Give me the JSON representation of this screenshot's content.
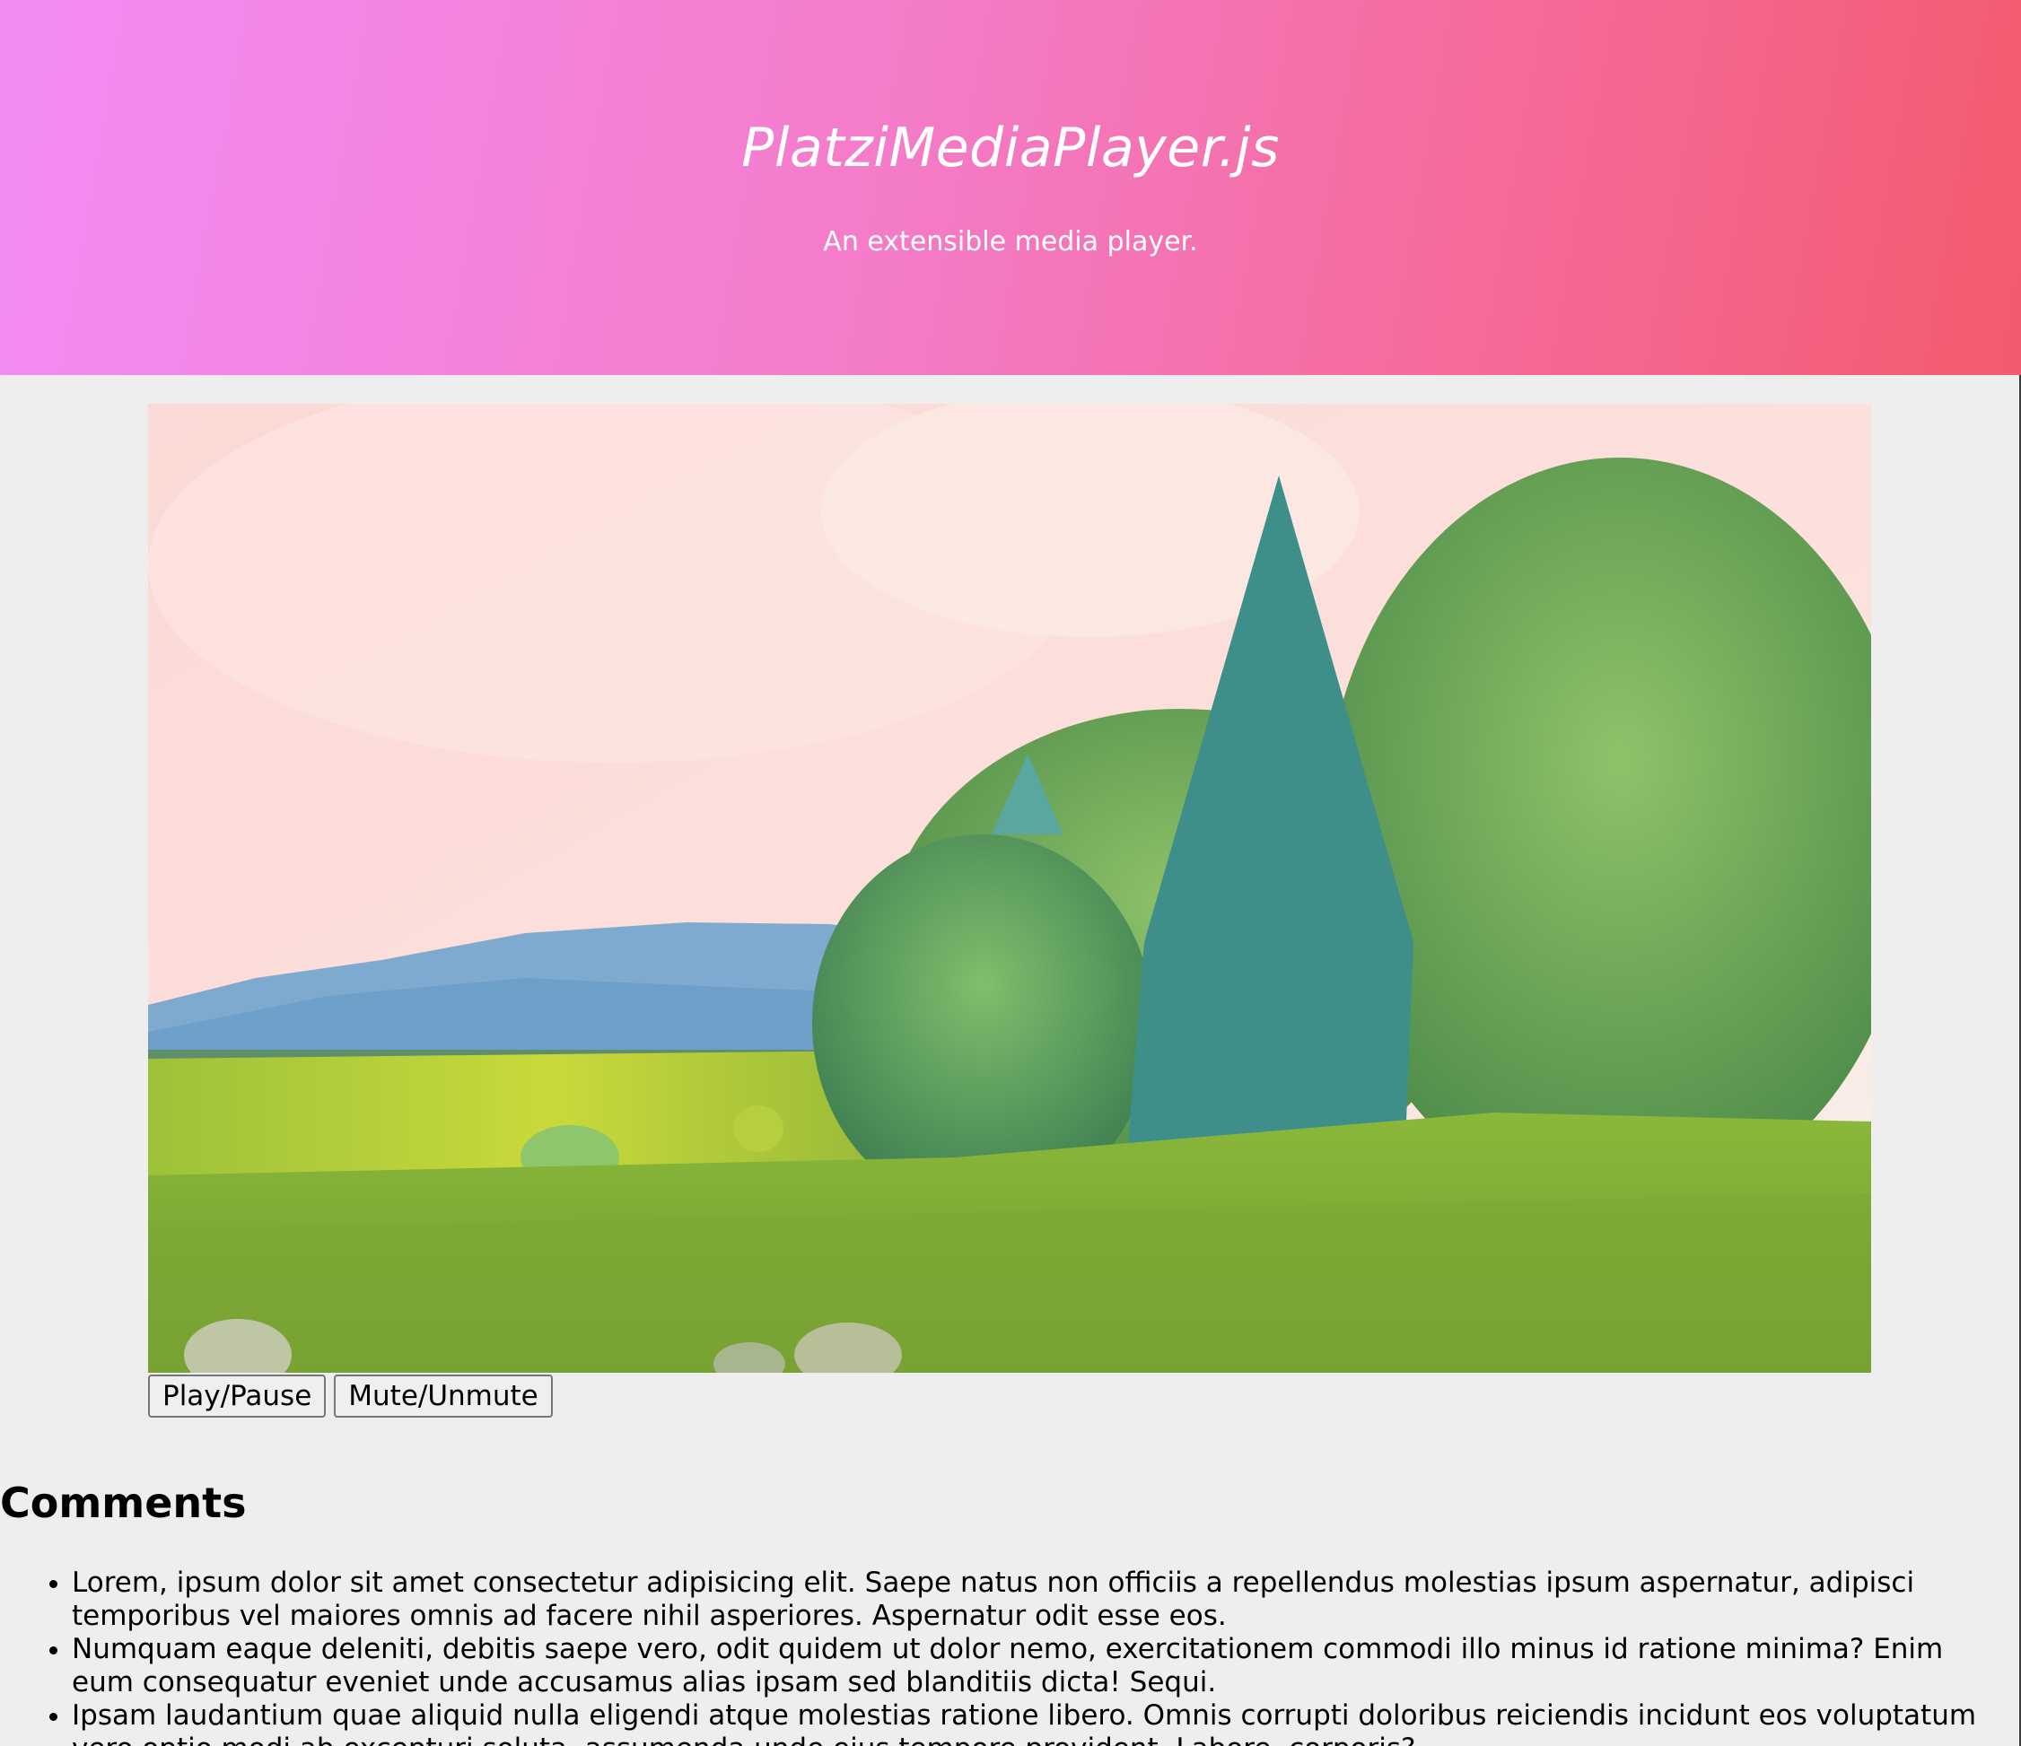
{
  "header": {
    "title": "PlatziMediaPlayer.js",
    "subtitle": "An extensible media player."
  },
  "player": {
    "video_description_icon": "video-frame",
    "play_pause_label": "Play/Pause",
    "mute_unmute_label": "Mute/Unmute"
  },
  "comments": {
    "heading": "Comments",
    "items": [
      "Lorem, ipsum dolor sit amet consectetur adipisicing elit. Saepe natus non officiis a repellendus molestias ipsum aspernatur, adipisci temporibus vel maiores omnis ad facere nihil asperiores. Aspernatur odit esse eos.",
      "Numquam eaque deleniti, debitis saepe vero, odit quidem ut dolor nemo, exercitationem commodi illo minus id ratione minima? Enim eum consequatur eveniet unde accusamus alias ipsam sed blanditiis dicta! Sequi.",
      "Ipsam laudantium quae aliquid nulla eligendi atque molestias ratione libero. Omnis corrupti doloribus reiciendis incidunt eos voluptatum vero optio modi ab excepturi soluta, assumenda unde eius tempore provident. Labore, corporis?"
    ]
  },
  "colors": {
    "header_gradient_start": "#f28cf5",
    "header_gradient_end": "#f45a6e",
    "page_background": "#eeeeee"
  }
}
